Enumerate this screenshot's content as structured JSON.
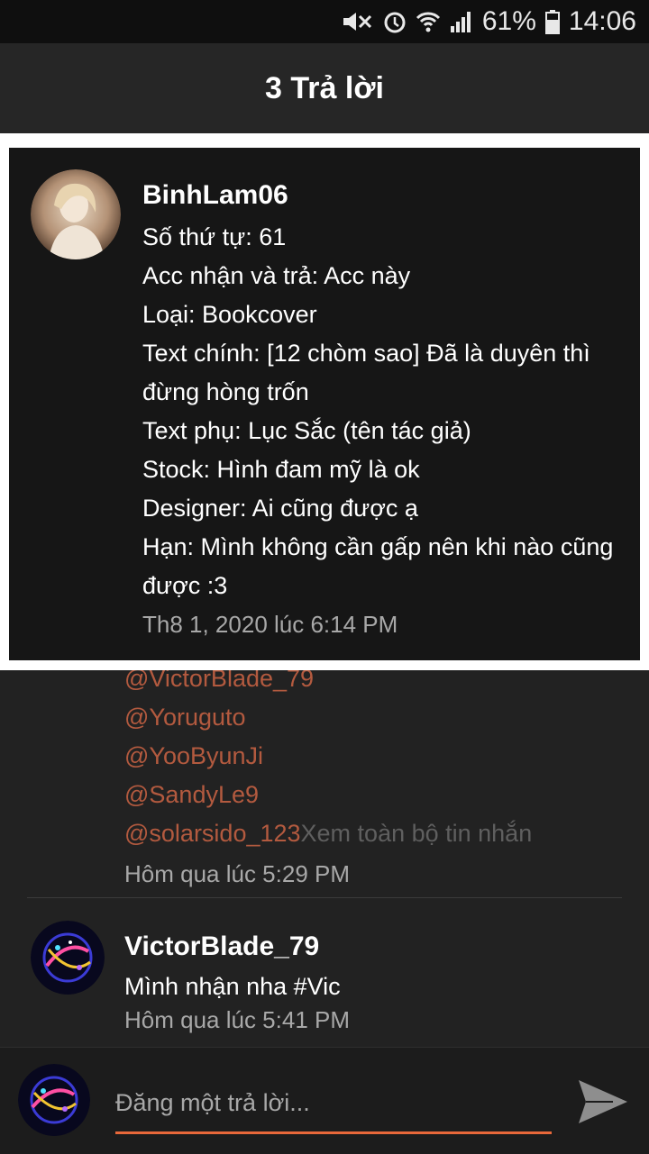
{
  "status_bar": {
    "battery": "61%",
    "time": "14:06"
  },
  "header": {
    "title": "3 Trả lời"
  },
  "highlighted_comment": {
    "username": "BinhLam06",
    "lines": [
      "Số thứ tự: 61",
      "Acc nhận và trả: Acc này",
      "Loại: Bookcover",
      "Text chính: [12 chòm sao] Đã là duyên thì đừng hòng trốn",
      "Text phụ: Lục Sắc (tên tác giả)",
      "Stock: Hình đam mỹ là ok",
      "Designer: Ai cũng được ạ",
      "Hạn: Mình không cần gấp nên khi nào cũng được :3"
    ],
    "timestamp": "Th8 1, 2020 lúc 6:14 PM"
  },
  "reply_1": {
    "mentions": [
      "@VictorBlade_79",
      "@Yoruguto",
      "@YooByunJi",
      "@SandyLe9",
      "@solarsido_123"
    ],
    "see_more": "Xem toàn bộ tin nhắn",
    "timestamp": "Hôm qua lúc 5:29 PM"
  },
  "reply_2": {
    "username": "VictorBlade_79",
    "text": "Mình nhận nha #Vic",
    "timestamp": "Hôm qua lúc 5:41 PM"
  },
  "composer": {
    "placeholder": "Đăng một trả lời..."
  },
  "colors": {
    "mention": "#b35a3f",
    "accent": "#e8683a"
  }
}
